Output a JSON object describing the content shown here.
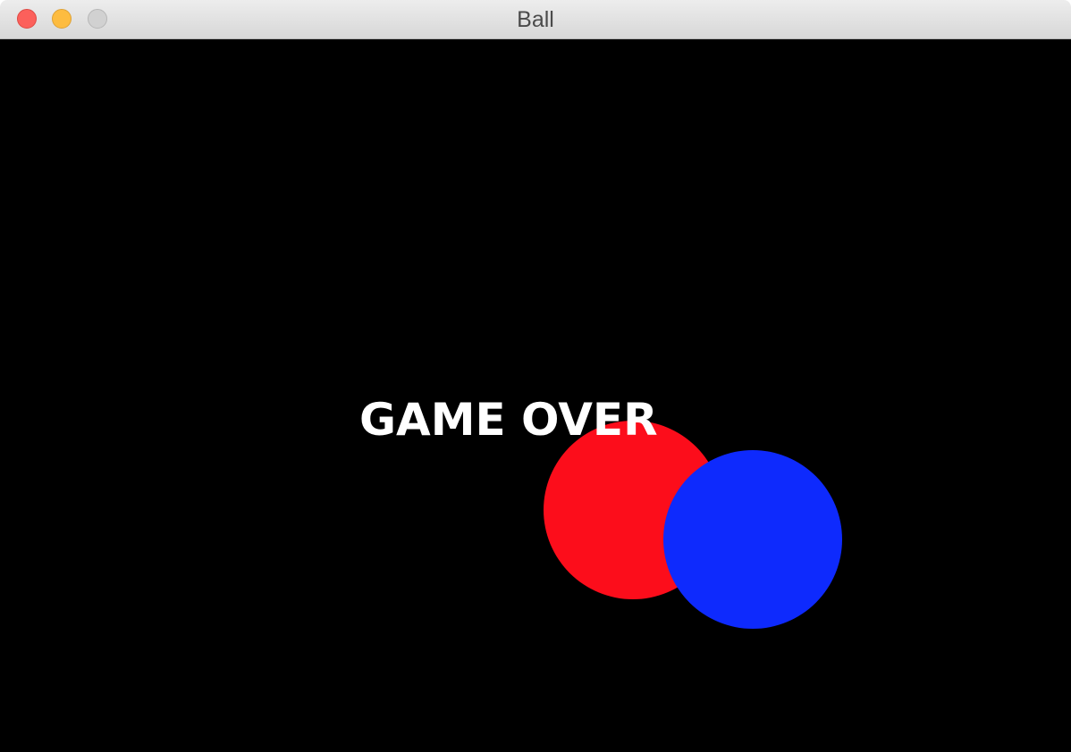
{
  "window": {
    "title": "Ball"
  },
  "game": {
    "status_text": "GAME OVER",
    "background_color": "#000000",
    "balls": [
      {
        "name": "red-ball",
        "color": "#fc0d1b"
      },
      {
        "name": "blue-ball",
        "color": "#0e2afd"
      }
    ]
  },
  "icons": {
    "close": "close-icon",
    "minimize": "minimize-icon",
    "zoom": "zoom-icon"
  }
}
